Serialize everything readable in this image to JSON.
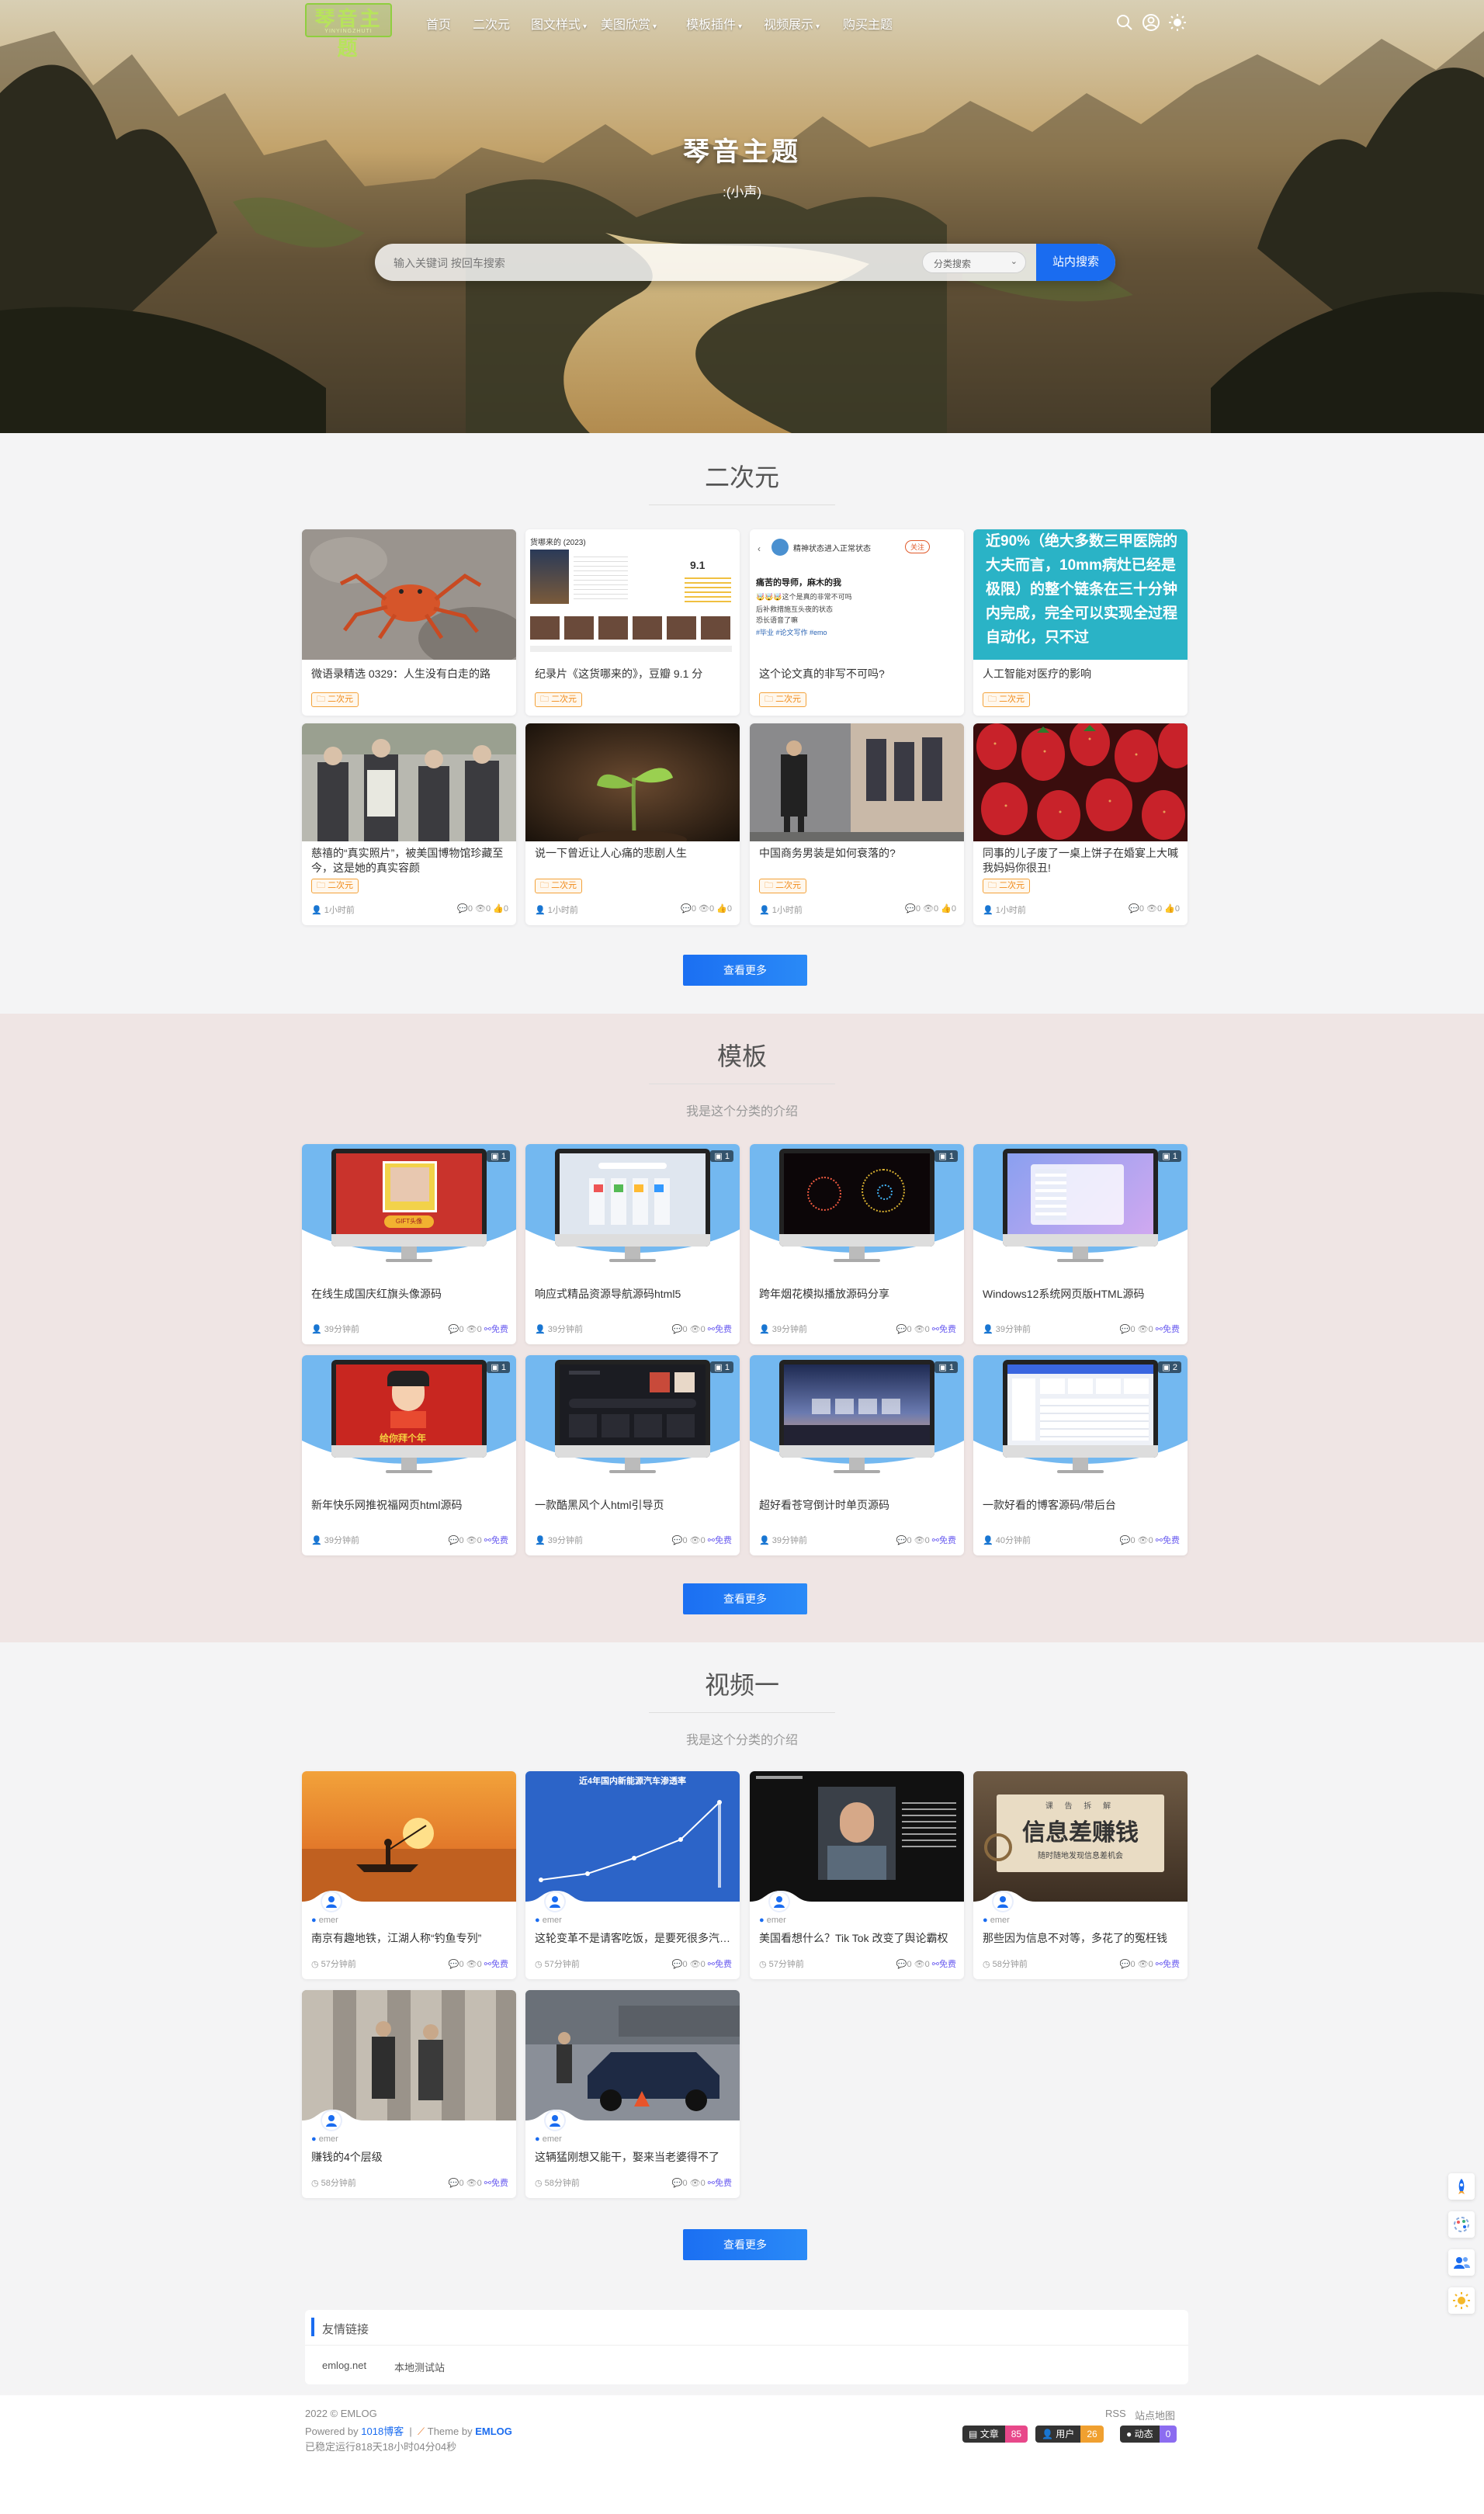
{
  "nav": {
    "logo": "琴音主题",
    "logo_sub": "YINYINGZHUTI",
    "items": [
      "首页",
      "二次元",
      "图文样式",
      "美图欣赏",
      "模板插件",
      "视频展示",
      "购买主题"
    ],
    "has_caret": [
      false,
      false,
      true,
      true,
      true,
      true,
      false
    ]
  },
  "hero": {
    "title": "琴音主题",
    "subtitle": ":(小声)",
    "search_placeholder": "输入关键词 按回车搜索",
    "category_select": "分类搜索",
    "search_button": "站内搜索"
  },
  "sections": {
    "anime": {
      "title": "二次元",
      "more": "查看更多",
      "cards": [
        {
          "title": "微语录精选 0329：人生没有白走的路",
          "tag": "二次元"
        },
        {
          "title": "纪录片《这货哪来的》，豆瓣 9.1 分",
          "tag": "二次元"
        },
        {
          "title": "这个论文真的非写不可吗?",
          "tag": "二次元"
        },
        {
          "title": "人工智能对医疗的影响",
          "tag": "二次元"
        },
        {
          "title": "慈禧的“真实照片”，被美国博物馆珍藏至今，这是她的真实容颜",
          "tag": "二次元",
          "time": "1小时前",
          "comments": "0",
          "views": "0",
          "likes": "0"
        },
        {
          "title": "说一下曾近让人心痛的悲剧人生",
          "tag": "二次元",
          "time": "1小时前",
          "comments": "0",
          "views": "0",
          "likes": "0"
        },
        {
          "title": "中国商务男装是如何衰落的?",
          "tag": "二次元",
          "time": "1小时前",
          "comments": "0",
          "views": "0",
          "likes": "0"
        },
        {
          "title": "同事的儿子废了一桌上饼子在婚宴上大喊我妈妈你很丑!",
          "tag": "二次元",
          "time": "1小时前",
          "comments": "0",
          "views": "0",
          "likes": "0"
        }
      ],
      "card2_text": {
        "head": "货哪来的 (2023)",
        "score": "9.1"
      },
      "card3_text": {
        "head": "精神状态进入正常状态",
        "follow": "关注",
        "l1": "痛苦的导师，麻木的我",
        "l2": "🤯🤯🤯这个是真的非常不可吗",
        "l3": "后补救措施互头夜的状态",
        "l4": "恐长语音了嘛",
        "tags": "#毕业 #论文写作 #emo"
      },
      "card4_text": "近90%（绝大多数三甲医院的大夫而言，10mm病灶已经是极限）的整个链条在三十分钟内完成，完全可以实现全过程自动化，只不过"
    },
    "templates": {
      "title": "模板",
      "desc": "我是这个分类的介绍",
      "more": "查看更多",
      "cards": [
        {
          "title": "在线生成国庆红旗头像源码",
          "time": "39分钟前",
          "comments": "0",
          "views": "0",
          "price": "免费",
          "img_count": "1",
          "screen_text": "GIFT头像"
        },
        {
          "title": "响应式精品资源导航源码html5",
          "time": "39分钟前",
          "comments": "0",
          "views": "0",
          "price": "免费",
          "img_count": "1"
        },
        {
          "title": "跨年烟花模拟播放源码分享",
          "time": "39分钟前",
          "comments": "0",
          "views": "0",
          "price": "免费",
          "img_count": "1"
        },
        {
          "title": "Windows12系统网页版HTML源码",
          "time": "39分钟前",
          "comments": "0",
          "views": "0",
          "price": "免费",
          "img_count": "1"
        },
        {
          "title": "新年快乐网推祝福网页html源码",
          "time": "39分钟前",
          "comments": "0",
          "views": "0",
          "price": "免费",
          "img_count": "1",
          "screen_text": "给你拜个年"
        },
        {
          "title": "一款酷黑风个人html引导页",
          "time": "39分钟前",
          "comments": "0",
          "views": "0",
          "price": "免费",
          "img_count": "1"
        },
        {
          "title": "超好看苍穹倒计时单页源码",
          "time": "39分钟前",
          "comments": "0",
          "views": "0",
          "price": "免费",
          "img_count": "1"
        },
        {
          "title": "一款好看的博客源码/带后台",
          "time": "40分钟前",
          "comments": "0",
          "views": "0",
          "price": "免费",
          "img_count": "2"
        }
      ]
    },
    "videos": {
      "title": "视频一",
      "desc": "我是这个分类的介绍",
      "more": "查看更多",
      "cards": [
        {
          "author": "emer",
          "title": "南京有趣地铁，江湖人称“钓鱼专列”",
          "time": "57分钟前",
          "comments": "0",
          "views": "0",
          "price": "免费"
        },
        {
          "author": "emer",
          "title": "这轮变革不是请客吃饭，是要死很多汽车...",
          "time": "57分钟前",
          "comments": "0",
          "views": "0",
          "price": "免费",
          "chart_title": "近4年国内新能源汽车渗透率"
        },
        {
          "author": "emer",
          "title": "美国看想什么？Tik Tok 改变了舆论霸权",
          "time": "57分钟前",
          "comments": "0",
          "views": "0",
          "price": "免费"
        },
        {
          "author": "emer",
          "title": "那些因为信息不对等，多花了的冤枉钱",
          "time": "58分钟前",
          "comments": "0",
          "views": "0",
          "price": "免费",
          "banner": "信息差赚钱",
          "banner_top": "课  告  拆  解",
          "banner_sub": "随时随地发现信息差机会"
        },
        {
          "author": "emer",
          "title": "赚钱的4个层级",
          "time": "58分钟前",
          "comments": "0",
          "views": "0",
          "price": "免费"
        },
        {
          "author": "emer",
          "title": "这辆猛刚想又能干，娶来当老婆得不了",
          "time": "58分钟前",
          "comments": "0",
          "views": "0",
          "price": "免费"
        }
      ]
    }
  },
  "friends": {
    "title": "友情链接",
    "links": [
      "emlog.net",
      "本地测试站"
    ]
  },
  "footer": {
    "copyright": "2022 © EMLOG",
    "powered_prefix": "Powered by",
    "powered": "1018博客",
    "theme_prefix": "Theme by",
    "theme": "EMLOG",
    "uptime": "已稳定运行818天18小时04分04秒",
    "rss": "RSS",
    "sitemap": "站点地图",
    "stats": [
      {
        "label": "文章",
        "value": "85",
        "color": "#e8488a"
      },
      {
        "label": "用户",
        "value": "26",
        "color": "#f0a030"
      },
      {
        "label": "动态",
        "value": "0",
        "color": "#8c6cf0"
      }
    ]
  },
  "colors": {
    "accent": "#1a6cf0",
    "tag": "#f08a18",
    "free": "#6a5cf0"
  }
}
